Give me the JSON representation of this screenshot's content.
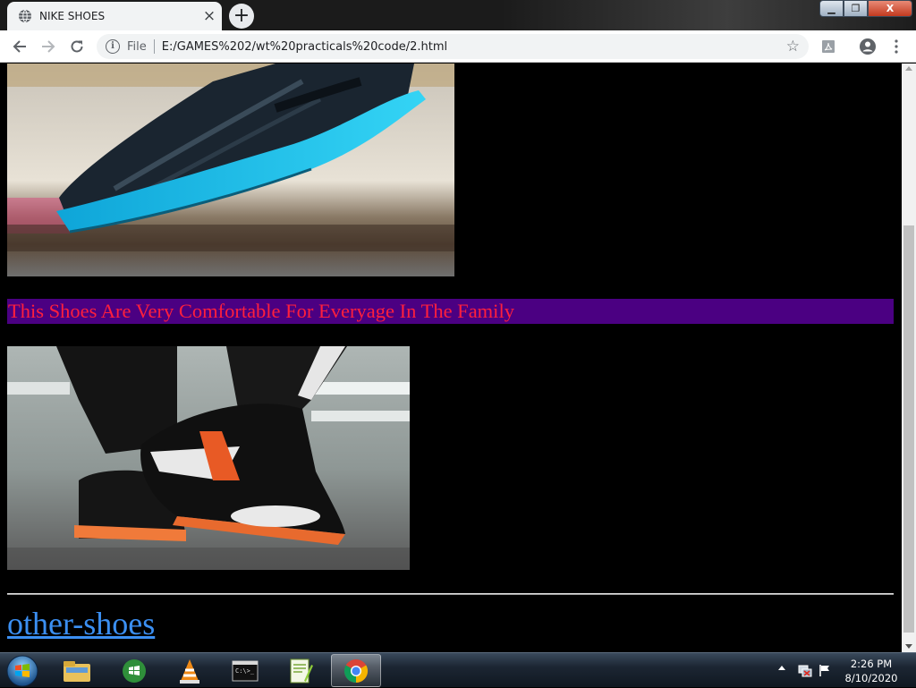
{
  "browser": {
    "tab_title": "NIKE SHOES",
    "tab_close": "×",
    "new_tab": "+",
    "scheme_label": "File",
    "url": "E:/GAMES%202/wt%20practicals%20code/2.html",
    "info_glyph": "i"
  },
  "window_controls": {
    "minimize": "▁",
    "maximize": "❐",
    "close": "X"
  },
  "page": {
    "caption": "This Shoes Are Very Comfortable For Everyage In The Family",
    "link_text": "other-shoes",
    "colors": {
      "background": "#000000",
      "caption_bg": "#4b0082",
      "caption_text": "#ff1f3d",
      "link": "#3b8ff2"
    }
  },
  "taskbar": {
    "time": "2:26 PM",
    "date": "8/10/2020",
    "apps": [
      "windows-explorer",
      "media-center",
      "vlc",
      "command-prompt",
      "notepad-plus-plus",
      "google-chrome"
    ]
  }
}
